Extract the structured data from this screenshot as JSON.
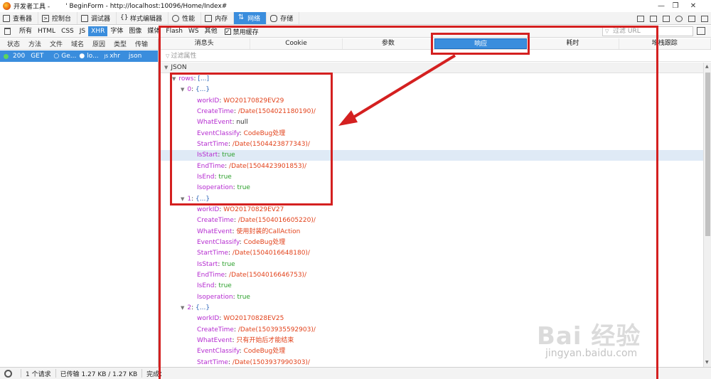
{
  "window": {
    "app_title": "开发者工具 -",
    "page_title": "' BeginForm - http://localhost:10096/Home/Index#"
  },
  "main_tabs": [
    {
      "label": "查看器",
      "icon": "inspector-icon"
    },
    {
      "label": "控制台",
      "icon": "console-icon"
    },
    {
      "label": "调试器",
      "icon": "debugger-icon"
    },
    {
      "label": "样式编辑器",
      "icon": "style-editor-icon"
    },
    {
      "label": "性能",
      "icon": "performance-icon"
    },
    {
      "label": "内存",
      "icon": "memory-icon"
    },
    {
      "label": "网络",
      "icon": "network-icon",
      "active": true
    },
    {
      "label": "存储",
      "icon": "storage-icon"
    }
  ],
  "filter_tabs": [
    "所有",
    "HTML",
    "CSS",
    "JS",
    "XHR",
    "字体",
    "图像",
    "媒体",
    "Flash",
    "WS",
    "其他"
  ],
  "filter_active": "XHR",
  "disable_cache": {
    "label": "禁用缓存",
    "checked": true
  },
  "url_filter_placeholder": "过滤 URL",
  "request_columns": [
    "状态",
    "方法",
    "文件",
    "域名",
    "原因",
    "类型",
    "传输"
  ],
  "request_row": {
    "status": "200",
    "method": "GET",
    "file": "Ge...",
    "domain": "lo...",
    "cause": "xhr",
    "type": "json"
  },
  "detail_tabs": [
    "消息头",
    "Cookie",
    "参数",
    "响应",
    "耗时",
    "堆栈跟踪"
  ],
  "detail_active": "响应",
  "prop_filter_placeholder": "过滤属性",
  "json_header": "JSON",
  "json_lines": [
    {
      "indent": 0,
      "key": "rows",
      "obj": "[...]",
      "tri": true
    },
    {
      "indent": 1,
      "key": "0",
      "obj": "{...}",
      "tri": true
    },
    {
      "indent": 2,
      "key": "workID",
      "val": "WO20170829EV29",
      "vtype": "s"
    },
    {
      "indent": 2,
      "key": "CreateTime",
      "val": "/Date(1504021180190)/",
      "vtype": "s"
    },
    {
      "indent": 2,
      "key": "WhatEvent",
      "val": "null",
      "vtype": "n"
    },
    {
      "indent": 2,
      "key": "EventClassify",
      "val": "CodeBug处理",
      "vtype": "s"
    },
    {
      "indent": 2,
      "key": "StartTime",
      "val": "/Date(1504423877343)/",
      "vtype": "s"
    },
    {
      "indent": 2,
      "key": "IsStart",
      "val": "true",
      "vtype": "b",
      "highlight": true
    },
    {
      "indent": 2,
      "key": "EndTime",
      "val": "/Date(1504423901853)/",
      "vtype": "s"
    },
    {
      "indent": 2,
      "key": "IsEnd",
      "val": "true",
      "vtype": "b"
    },
    {
      "indent": 2,
      "key": "Isoperation",
      "val": "true",
      "vtype": "b"
    },
    {
      "indent": 1,
      "key": "1",
      "obj": "{...}",
      "tri": true
    },
    {
      "indent": 2,
      "key": "workID",
      "val": "WO20170829EV27",
      "vtype": "s"
    },
    {
      "indent": 2,
      "key": "CreateTime",
      "val": "/Date(1504016605220)/",
      "vtype": "s"
    },
    {
      "indent": 2,
      "key": "WhatEvent",
      "val": "使用封装的CallAction",
      "vtype": "s"
    },
    {
      "indent": 2,
      "key": "EventClassify",
      "val": "CodeBug处理",
      "vtype": "s"
    },
    {
      "indent": 2,
      "key": "StartTime",
      "val": "/Date(1504016648180)/",
      "vtype": "s"
    },
    {
      "indent": 2,
      "key": "IsStart",
      "val": "true",
      "vtype": "b"
    },
    {
      "indent": 2,
      "key": "EndTime",
      "val": "/Date(1504016646753)/",
      "vtype": "s"
    },
    {
      "indent": 2,
      "key": "IsEnd",
      "val": "true",
      "vtype": "b"
    },
    {
      "indent": 2,
      "key": "Isoperation",
      "val": "true",
      "vtype": "b"
    },
    {
      "indent": 1,
      "key": "2",
      "obj": "{...}",
      "tri": true
    },
    {
      "indent": 2,
      "key": "workID",
      "val": "WO20170828EV25",
      "vtype": "s"
    },
    {
      "indent": 2,
      "key": "CreateTime",
      "val": "/Date(1503935592903)/",
      "vtype": "s"
    },
    {
      "indent": 2,
      "key": "WhatEvent",
      "val": "只有开始后才能结束",
      "vtype": "s"
    },
    {
      "indent": 2,
      "key": "EventClassify",
      "val": "CodeBug处理",
      "vtype": "s"
    },
    {
      "indent": 2,
      "key": "StartTime",
      "val": "/Date(1503937990303)/",
      "vtype": "s"
    },
    {
      "indent": 2,
      "key": "IsStart",
      "val": "true",
      "vtype": "b"
    }
  ],
  "status_bar": {
    "requests": "1 个请求",
    "transferred": "已传输 1.27 KB / 1.27 KB",
    "finished": "完成："
  },
  "watermark": {
    "logo": "Bai 经验",
    "url": "jingyan.baidu.com"
  },
  "colors": {
    "accent": "#3a8ddd",
    "annotation_red": "#d42020",
    "json_key": "#b52bd0",
    "json_string": "#e2421b",
    "json_bool": "#2ca02c"
  }
}
